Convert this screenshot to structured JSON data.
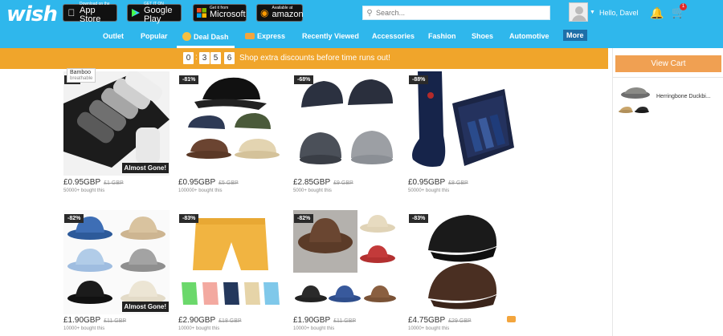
{
  "header": {
    "logo": "wish",
    "stores": [
      {
        "small": "Download on the",
        "big": "App Store",
        "icon": "apple-icon"
      },
      {
        "small": "GET IT ON",
        "big": "Google Play",
        "icon": "play-icon"
      },
      {
        "small": "Get it from",
        "big": "Microsoft",
        "icon": "windows-icon"
      },
      {
        "small": "Available at",
        "big": "amazon",
        "icon": "amazon-icon"
      }
    ],
    "search_placeholder": "Search...",
    "greeting": "Hello, Davel",
    "cart_count": "1"
  },
  "nav": {
    "items": [
      "Outlet",
      "Popular",
      "Deal Dash",
      "Express",
      "Recently Viewed",
      "Accessories",
      "Fashion",
      "Shoes",
      "Automotive",
      "More"
    ],
    "active": "Deal Dash"
  },
  "banner": {
    "timer": [
      "0",
      "3",
      "5",
      "6"
    ],
    "separator": ":",
    "text": "Shop extra discounts before time runs out!"
  },
  "sidebar": {
    "view_cart": "View Cart",
    "cart_item_name": "Herringbone Duckbi..."
  },
  "products": [
    {
      "discount": "-5%",
      "price": "£0.95GBP",
      "old_price": "£1 GBP",
      "bought": "50000+ bought this",
      "almost_gone": "Almost Gone!",
      "tag_line1": "Bamboo",
      "tag_line2": "breathable"
    },
    {
      "discount": "-81%",
      "price": "£0.95GBP",
      "old_price": "£5 GBP",
      "bought": "100000+ bought this"
    },
    {
      "discount": "-68%",
      "price": "£2.85GBP",
      "old_price": "£9 GBP",
      "bought": "5000+ bought this"
    },
    {
      "discount": "-88%",
      "price": "£0.95GBP",
      "old_price": "£8 GBP",
      "bought": "50000+ bought this"
    },
    {
      "discount": "-82%",
      "price": "£1.90GBP",
      "old_price": "£11 GBP",
      "bought": "10000+ bought this",
      "almost_gone": "Almost Gone!"
    },
    {
      "discount": "-83%",
      "price": "£2.90GBP",
      "old_price": "£18 GBP",
      "bought": "10000+ bought this"
    },
    {
      "discount": "-82%",
      "price": "£1.90GBP",
      "old_price": "£11 GBP",
      "bought": "10000+ bought this"
    },
    {
      "discount": "-83%",
      "price": "£4.75GBP",
      "old_price": "£29 GBP",
      "bought": "10000+ bought this"
    }
  ]
}
